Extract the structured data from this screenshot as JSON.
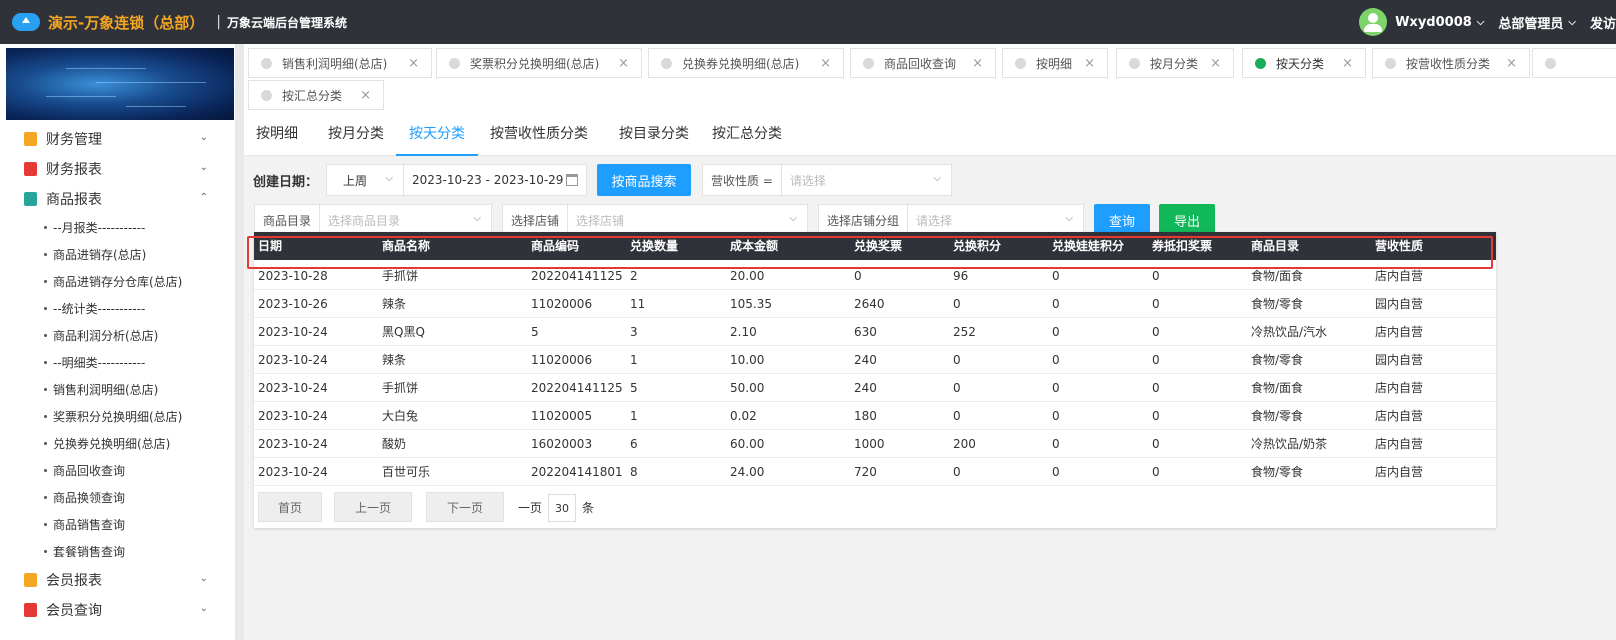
{
  "header": {
    "app_title": "演示-万象连锁（总部）",
    "separator": "|",
    "subtitle": "万象云端后台管理系统",
    "user": "Wxyd0008",
    "role": "总部管理员",
    "more": "发访"
  },
  "sidebar": {
    "groups_top": [
      {
        "label": "财务管理",
        "icon_color": "#f5a623",
        "icon": "ledger-icon"
      },
      {
        "label": "财务报表",
        "icon_color": "#e53935",
        "icon": "report-icon"
      },
      {
        "label": "商品报表",
        "icon_color": "#26a69a",
        "icon": "goods-report-icon"
      }
    ],
    "sub_items": [
      "--月报类-----------",
      "商品进销存(总店)",
      "商品进销存分仓库(总店)",
      "--统计类-----------",
      "商品利润分析(总店)",
      "--明细类-----------",
      "销售利润明细(总店)",
      "奖票积分兑换明细(总店)",
      "兑换券兑换明细(总店)",
      "商品回收查询",
      "商品换领查询",
      "商品销售查询",
      "套餐销售查询"
    ],
    "groups_bottom": [
      {
        "label": "会员报表",
        "icon_color": "#f5a623",
        "icon": "member-report-icon"
      },
      {
        "label": "会员查询",
        "icon_color": "#e53935",
        "icon": "member-query-icon"
      }
    ]
  },
  "tabs": [
    {
      "label": "销售利润明细(总店)",
      "active": false
    },
    {
      "label": "奖票积分兑换明细(总店)",
      "active": false
    },
    {
      "label": "兑换券兑换明细(总店)",
      "active": false
    },
    {
      "label": "商品回收查询",
      "active": false
    },
    {
      "label": "按明细",
      "active": false
    },
    {
      "label": "按月分类",
      "active": false
    },
    {
      "label": "按天分类",
      "active": true
    },
    {
      "label": "按营收性质分类",
      "active": false
    },
    {
      "label": "按汇总分类",
      "active": false
    }
  ],
  "subtabs": [
    "按明细",
    "按月分类",
    "按天分类",
    "按营收性质分类",
    "按目录分类",
    "按汇总分类"
  ],
  "subtab_active": 2,
  "filters": {
    "date_label": "创建日期：",
    "period": "上周",
    "date_range": "2023-10-23 - 2023-10-29",
    "search_by_goods": "按商品搜索",
    "revenue_label": "营收性质 =",
    "revenue_placeholder": "请选择",
    "catalog_label": "商品目录",
    "catalog_placeholder": "选择商品目录",
    "store_label": "选择店铺",
    "store_placeholder": "选择店铺",
    "store_group_label": "选择店铺分组",
    "store_group_placeholder": "请选择",
    "query_button": "查询",
    "export_button": "导出"
  },
  "table": {
    "columns": [
      "日期",
      "商品名称",
      "商品编码",
      "兑换数量",
      "成本金额",
      "兑换奖票",
      "兑换积分",
      "兑换娃娃积分",
      "券抵扣奖票",
      "商品目录",
      "营收性质"
    ],
    "rows": [
      [
        "2023-10-28",
        "手抓饼",
        "202204141125",
        "2",
        "20.00",
        "0",
        "96",
        "0",
        "0",
        "食物/面食",
        "店内自营"
      ],
      [
        "2023-10-26",
        "辣条",
        "11020006",
        "11",
        "105.35",
        "2640",
        "0",
        "0",
        "0",
        "食物/零食",
        "园内自营"
      ],
      [
        "2023-10-24",
        "黑Q黑Q",
        "5",
        "3",
        "2.10",
        "630",
        "252",
        "0",
        "0",
        "冷热饮品/汽水",
        "店内自营"
      ],
      [
        "2023-10-24",
        "辣条",
        "11020006",
        "1",
        "10.00",
        "240",
        "0",
        "0",
        "0",
        "食物/零食",
        "园内自营"
      ],
      [
        "2023-10-24",
        "手抓饼",
        "202204141125",
        "5",
        "50.00",
        "240",
        "0",
        "0",
        "0",
        "食物/面食",
        "店内自营"
      ],
      [
        "2023-10-24",
        "大白兔",
        "11020005",
        "1",
        "0.02",
        "180",
        "0",
        "0",
        "0",
        "食物/零食",
        "店内自营"
      ],
      [
        "2023-10-24",
        "酸奶",
        "16020003",
        "6",
        "60.00",
        "1000",
        "200",
        "0",
        "0",
        "冷热饮品/奶茶",
        "店内自营"
      ],
      [
        "2023-10-24",
        "百世可乐",
        "202204141801",
        "8",
        "24.00",
        "720",
        "0",
        "0",
        "0",
        "食物/零食",
        "店内自营"
      ]
    ]
  },
  "pager": {
    "first": "首页",
    "prev": "上一页",
    "next": "下一页",
    "per_page_prefix": "一页",
    "per_page": "30",
    "per_page_suffix": "条"
  },
  "colors": {
    "header_bg": "#2f3339",
    "accent_blue": "#1e9fff",
    "accent_green": "#11b85a",
    "title_orange": "#f5a623",
    "highlight_red": "#e53935"
  }
}
